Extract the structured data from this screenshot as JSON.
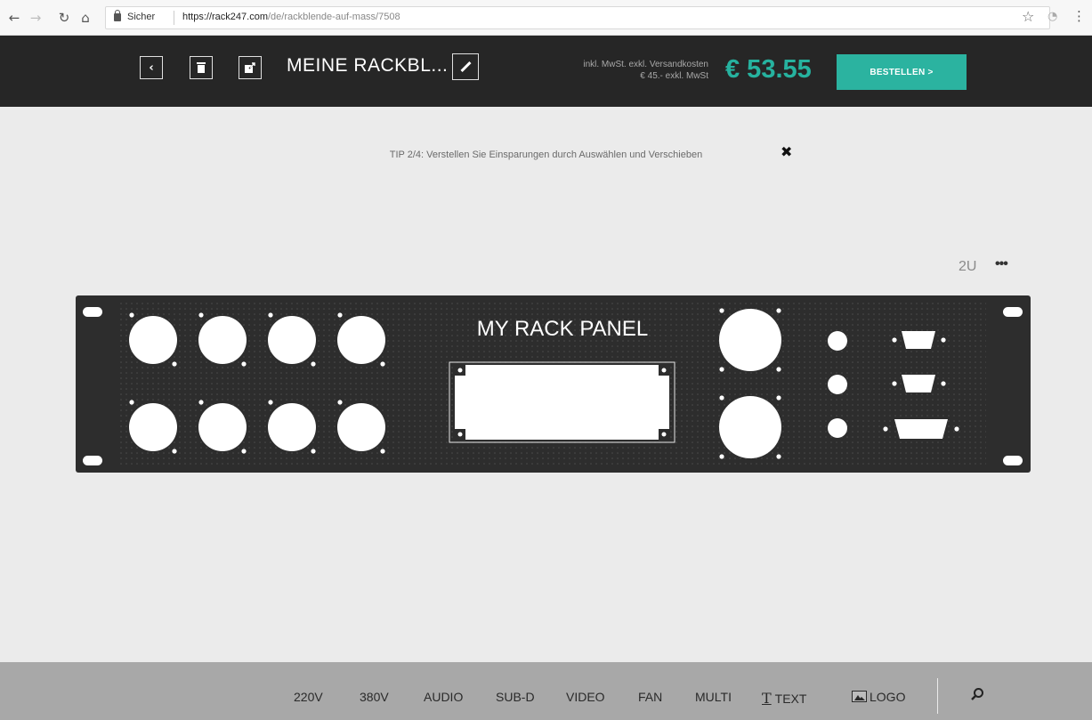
{
  "browser": {
    "secure_label": "Sicher",
    "url_host": "https://rack247.com",
    "url_path": "/de/rackblende-auf-mass/7508"
  },
  "header": {
    "title": "MEINE RACKBL...",
    "price_note_line1": "inkl. MwSt. exkl. Versandkosten",
    "price_note_line2": "€ 45.- exkl. MwSt",
    "price": "€ 53.55",
    "order_label": "BESTELLEN >"
  },
  "tip": {
    "text": "TIP 2/4: Verstellen Sie Einsparungen durch Auswählen und Verschieben"
  },
  "panel": {
    "size": "2U",
    "label": "MY RACK PANEL"
  },
  "toolbar": {
    "items": [
      "220V",
      "380V",
      "AUDIO",
      "SUB-D",
      "VIDEO",
      "FAN",
      "MULTI",
      "TEXT",
      "LOGO"
    ]
  },
  "colors": {
    "header_bg": "#262626",
    "accent": "#2bb3a0",
    "panel": "#2d2d2d",
    "toolbar_bg": "#a8a8a8"
  }
}
